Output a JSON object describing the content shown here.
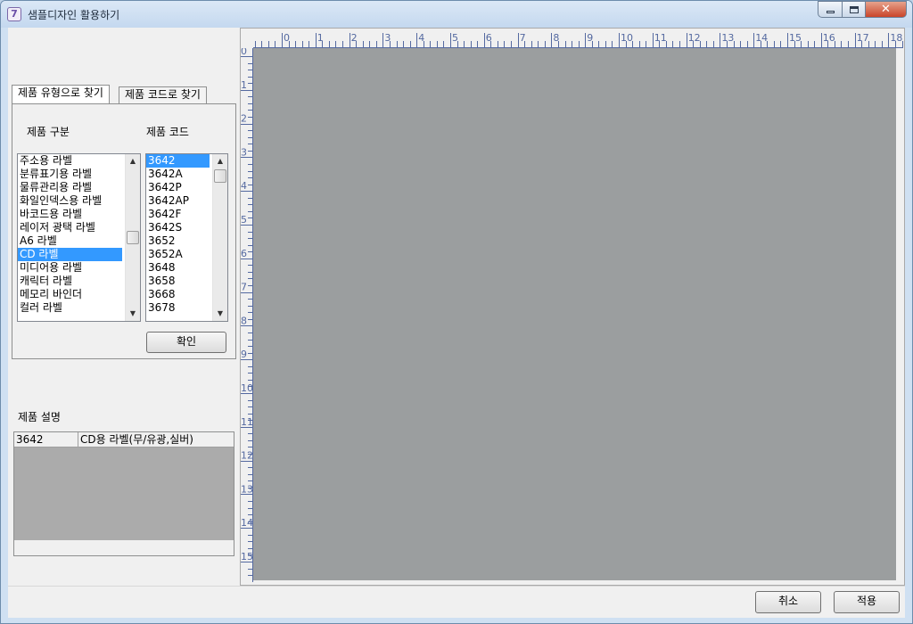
{
  "window": {
    "title": "샘플디자인 활용하기",
    "app_icon": "app-icon",
    "caption_buttons": [
      "minimize-icon",
      "maximize-icon",
      "close-icon"
    ]
  },
  "tabs": [
    {
      "label": "제품 유형으로 찾기",
      "active": true
    },
    {
      "label": "제품 코드로 찾기",
      "active": false
    }
  ],
  "category_list": {
    "header": "제품 구분",
    "items": [
      "주소용 라벨",
      "분류표기용 라벨",
      "물류관리용 라벨",
      "화일인덱스용 라벨",
      "바코드용 라벨",
      "레이저 광택 라벨",
      "A6 라벨",
      "CD 라벨",
      "미디어용 라벨",
      "캐릭터 라벨",
      "메모리 바인더",
      "컬러 라벨"
    ],
    "selected_index": 7
  },
  "code_list": {
    "header": "제품 코드",
    "items": [
      "3642",
      "3642A",
      "3642P",
      "3642AP",
      "3642F",
      "3642S",
      "3652",
      "3652A",
      "3648",
      "3658",
      "3668",
      "3678"
    ],
    "selected_index": 0
  },
  "confirm_button": "확인",
  "description": {
    "header": "제품 설명",
    "code": "3642",
    "text": "CD용 라벨(무/유광,실버)"
  },
  "ruler": {
    "horizontal_labels": [
      "0",
      "1",
      "2",
      "3",
      "4",
      "5",
      "6",
      "7",
      "8",
      "9",
      "10",
      "11",
      "12",
      "13",
      "14",
      "15",
      "16",
      "17",
      "18"
    ],
    "vertical_labels": [
      "0",
      "1",
      "2",
      "3",
      "4",
      "5",
      "6",
      "7",
      "8",
      "9",
      "10",
      "11",
      "12",
      "13",
      "14",
      "15"
    ]
  },
  "footer": {
    "cancel_label": "취소",
    "apply_label": "적용"
  },
  "colors": {
    "selection": "#3399ff",
    "canvas": "#9b9e9f",
    "ruler_text": "#5469a0"
  }
}
